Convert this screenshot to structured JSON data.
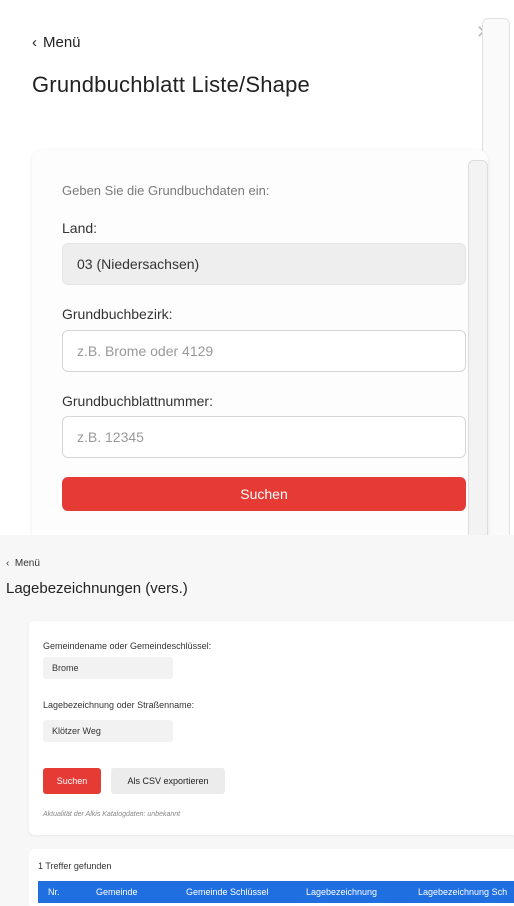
{
  "top": {
    "back_label": "Menü",
    "title": "Grundbuchblatt Liste/Shape",
    "intro": "Geben Sie die Grundbuchdaten ein:",
    "land_label": "Land:",
    "land_value": "03 (Niedersachsen)",
    "bezirk_label": "Grundbuchbezirk:",
    "bezirk_placeholder": "z.B. Brome oder 4129",
    "blatt_label": "Grundbuchblattnummer:",
    "blatt_placeholder": "z.B. 12345",
    "search_label": "Suchen"
  },
  "bottom": {
    "back_label": "Menü",
    "title": "Lagebezeichnungen (vers.)",
    "gemeinde_label": "Gemeindename oder Gemeindeschlüssel:",
    "gemeinde_value": "Brome",
    "lage_label": "Lagebezeichnung oder Straßenname:",
    "lage_value": "Klötzer Weg",
    "search_label": "Suchen",
    "csv_label": "Als CSV exportieren",
    "note": "Aktualität der Alkis Katalogdaten: unbekannt",
    "result_count": "1 Treffer gefunden",
    "columns": [
      "Nr.",
      "Gemeinde",
      "Gemeinde Schlüssel",
      "Lagebezeichnung",
      "Lagebezeichnung Sch"
    ]
  },
  "colors": {
    "accent": "#e63a35",
    "table_header": "#1f6fe0"
  }
}
